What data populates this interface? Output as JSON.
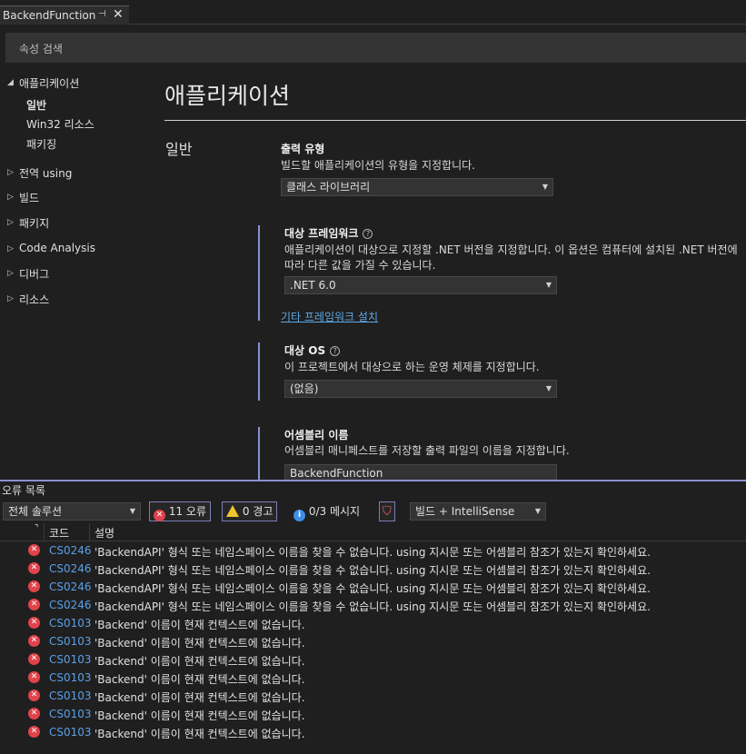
{
  "tab": {
    "title": "BackendFunction",
    "pin_glyph": "⊣",
    "close_glyph": "✕"
  },
  "search": {
    "placeholder": "속성 검색"
  },
  "nav": {
    "group_open": "애플리케이션",
    "subitems": [
      "일반",
      "Win32 리소스",
      "패키징"
    ],
    "groups": [
      "전역 using",
      "빌드",
      "패키지",
      "Code Analysis",
      "디버그",
      "리소스"
    ]
  },
  "page": {
    "title": "애플리케이션",
    "section": "일반",
    "output_type": {
      "title": "출력 유형",
      "desc": "빌드할 애플리케이션의 유형을 지정합니다.",
      "value": "클래스 라이브러리"
    },
    "target_framework": {
      "title": "대상 프레임워크",
      "desc": "애플리케이션이 대상으로 지정할 .NET 버전을 지정합니다. 이 옵션은 컴퓨터에 설치된 .NET 버전에 따라 다른 값을 가질 수 있습니다.",
      "value": ".NET 6.0",
      "link": "기타 프레임워크 설치"
    },
    "target_os": {
      "title": "대상 OS",
      "desc": "이 프로젝트에서 대상으로 하는 운영 체제를 지정합니다.",
      "value": "(없음)"
    },
    "assembly_name": {
      "title": "어셈블리 이름",
      "desc": "어셈블리 매니페스트를 저장할 출력 파일의 이름을 지정합니다.",
      "value": "BackendFunction"
    }
  },
  "error_list": {
    "title": "오류 목록",
    "scope": "전체 솔루션",
    "errors_label": "11 오류",
    "warnings_label": "0 경고",
    "messages_label": "0/3 메시지",
    "source": "빌드 + IntelliSense",
    "columns": {
      "code": "코드",
      "description": "설명"
    },
    "rows": [
      {
        "code": "CS0246",
        "desc": "'BackendAPI' 형식 또는 네임스페이스 이름을 찾을 수 없습니다. using 지시문 또는 어셈블리 참조가 있는지 확인하세요."
      },
      {
        "code": "CS0246",
        "desc": "'BackendAPI' 형식 또는 네임스페이스 이름을 찾을 수 없습니다. using 지시문 또는 어셈블리 참조가 있는지 확인하세요."
      },
      {
        "code": "CS0246",
        "desc": "'BackendAPI' 형식 또는 네임스페이스 이름을 찾을 수 없습니다. using 지시문 또는 어셈블리 참조가 있는지 확인하세요."
      },
      {
        "code": "CS0246",
        "desc": "'BackendAPI' 형식 또는 네임스페이스 이름을 찾을 수 없습니다. using 지시문 또는 어셈블리 참조가 있는지 확인하세요."
      },
      {
        "code": "CS0103",
        "desc": "'Backend' 이름이 현재 컨텍스트에 없습니다."
      },
      {
        "code": "CS0103",
        "desc": "'Backend' 이름이 현재 컨텍스트에 없습니다."
      },
      {
        "code": "CS0103",
        "desc": "'Backend' 이름이 현재 컨텍스트에 없습니다."
      },
      {
        "code": "CS0103",
        "desc": "'Backend' 이름이 현재 컨텍스트에 없습니다."
      },
      {
        "code": "CS0103",
        "desc": "'Backend' 이름이 현재 컨텍스트에 없습니다."
      },
      {
        "code": "CS0103",
        "desc": "'Backend' 이름이 현재 컨텍스트에 없습니다."
      },
      {
        "code": "CS0103",
        "desc": "'Backend' 이름이 현재 컨텍스트에 없습니다."
      }
    ]
  },
  "colors": {
    "accent": "#8a8fd0",
    "link": "#5fa8e8",
    "error": "#e0434b",
    "warning": "#f2c330",
    "info": "#3d8ee8"
  }
}
